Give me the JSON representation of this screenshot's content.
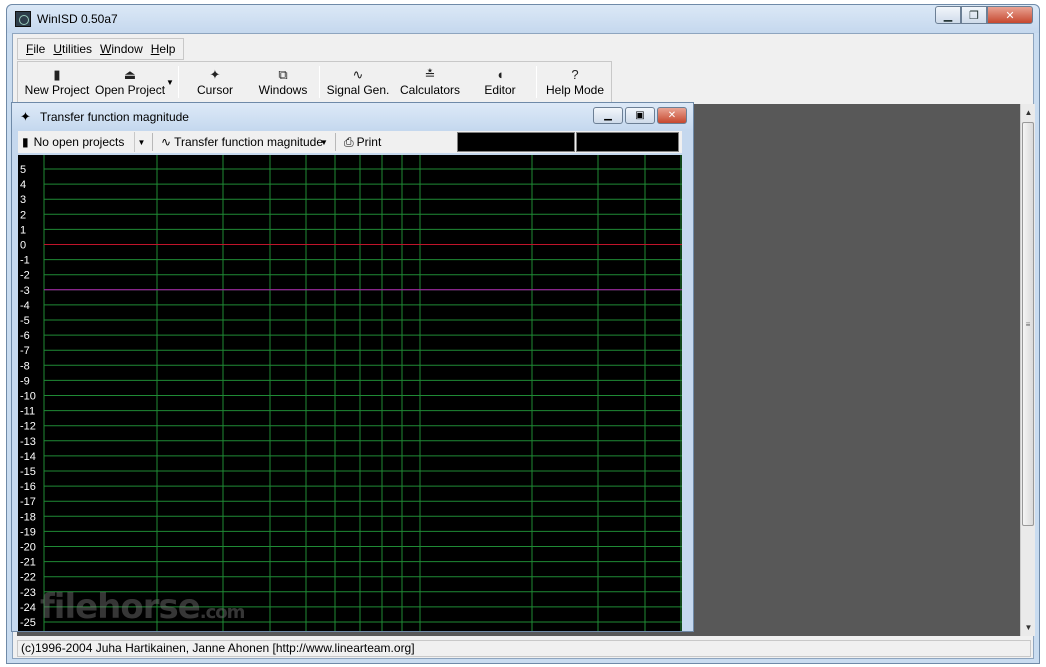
{
  "app": {
    "title": "WinISD 0.50a7"
  },
  "menu": [
    {
      "label": "File",
      "ul": "F",
      "rest": "ile"
    },
    {
      "label": "Utilities",
      "ul": "U",
      "rest": "tilities"
    },
    {
      "label": "Window",
      "ul": "W",
      "rest": "indow"
    },
    {
      "label": "Help",
      "ul": "H",
      "rest": "elp"
    }
  ],
  "toolbar": {
    "new_project": "New Project",
    "open_project": "Open Project",
    "cursor": "Cursor",
    "windows": "Windows",
    "signal_gen": "Signal Gen.",
    "calculators": "Calculators",
    "editor": "Editor",
    "help_mode": "Help Mode"
  },
  "child_window": {
    "title": "Transfer function magnitude",
    "projects_select": "No open projects",
    "graph_select": "Transfer function magnitude",
    "print": "Print"
  },
  "chart_data": {
    "type": "line",
    "ylim": [
      -25,
      5
    ],
    "yticks": [
      "5",
      "4",
      "3",
      "2",
      "1",
      "0",
      "-1",
      "-2",
      "-3",
      "-4",
      "-5",
      "-6",
      "-7",
      "-8",
      "-9",
      "-10",
      "-11",
      "-12",
      "-13",
      "-14",
      "-15",
      "-16",
      "-17",
      "-18",
      "-19",
      "-20",
      "-21",
      "-22",
      "-23",
      "-24",
      "-25"
    ],
    "reference_lines": [
      {
        "y": 0,
        "color": "#c0142a"
      },
      {
        "y": -3,
        "color": "#b01ab0"
      }
    ],
    "grid": true,
    "grid_color": "#1f8a35",
    "background": "#000000"
  },
  "status": {
    "text": "(c)1996-2004 Juha Hartikainen, Janne Ahonen [http://www.linearteam.org]"
  },
  "watermark": {
    "text": "filehorse",
    "suffix": ".com"
  }
}
